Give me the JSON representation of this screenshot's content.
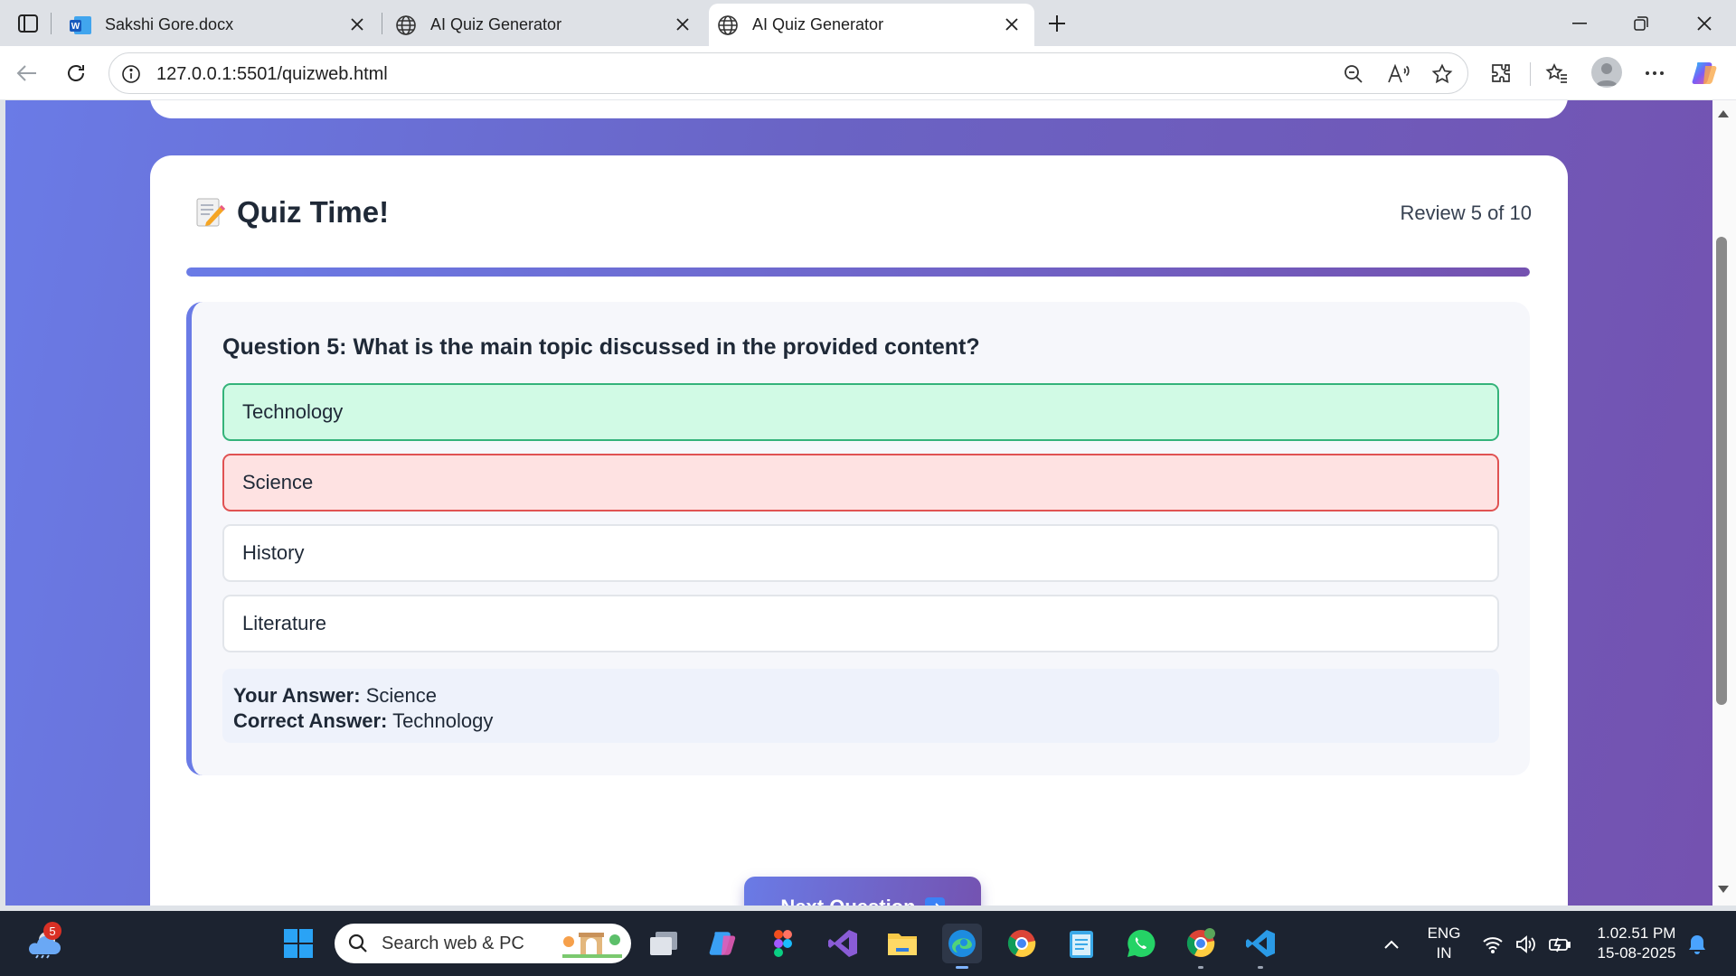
{
  "browser": {
    "tabs": [
      {
        "label": "Sakshi Gore.docx",
        "icon": "word-icon",
        "active": false
      },
      {
        "label": "AI Quiz Generator",
        "icon": "globe-icon",
        "active": false
      },
      {
        "label": "AI Quiz Generator",
        "icon": "globe-icon",
        "active": true
      }
    ],
    "url": "127.0.0.1:5501/quizweb.html"
  },
  "quiz": {
    "title": "Quiz Time!",
    "title_icon": "memo-icon",
    "review_counter": "Review 5 of 10",
    "progress": 1.0,
    "question": "Question 5: What is the main topic discussed in the provided content?",
    "options": [
      {
        "label": "Technology",
        "state": "correct"
      },
      {
        "label": "Science",
        "state": "wrong"
      },
      {
        "label": "History",
        "state": "neutral"
      },
      {
        "label": "Literature",
        "state": "neutral"
      }
    ],
    "your_answer_label": "Your Answer:",
    "your_answer": "Science",
    "correct_answer_label": "Correct Answer:",
    "correct_answer": "Technology",
    "next_button": "Next Question"
  },
  "colors": {
    "accent_start": "#6a7be6",
    "accent_end": "#7452b0",
    "correct_bg": "#d1fae5",
    "correct_border": "#34b37a",
    "wrong_bg": "#fee2e2",
    "wrong_border": "#e05252"
  },
  "taskbar": {
    "weather_badge": "5",
    "search_placeholder": "Search web & PC",
    "language_line1": "ENG",
    "language_line2": "IN",
    "time": "1.02.51 PM",
    "date": "15-08-2025",
    "apps": [
      "windows-start-icon",
      "file-manager-icon",
      "copilot-icon",
      "figma-icon",
      "visual-studio-icon",
      "file-explorer-icon",
      "edge-icon",
      "chrome-icon",
      "notepad-icon",
      "whatsapp-icon",
      "chrome-profile-icon",
      "vscode-icon"
    ]
  }
}
